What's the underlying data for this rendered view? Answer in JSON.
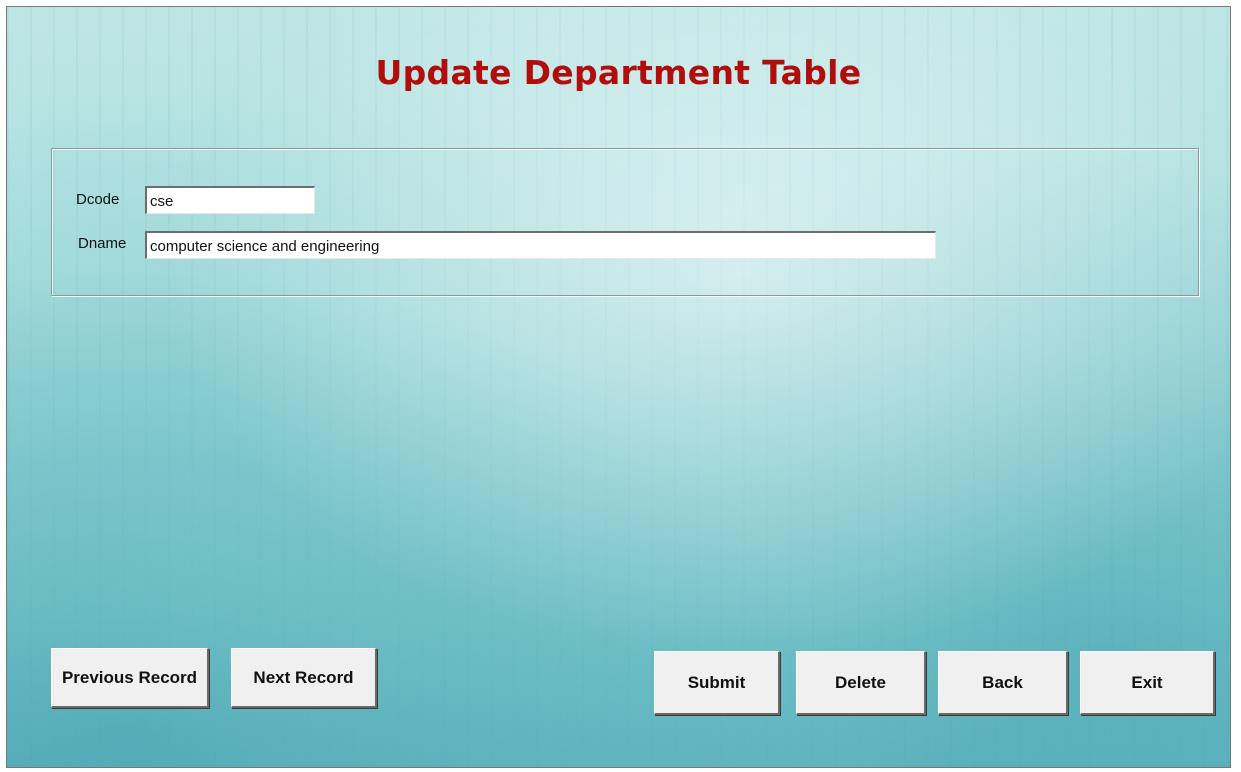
{
  "header": {
    "title": "Update Department Table"
  },
  "form": {
    "fields": [
      {
        "label": "Dcode",
        "value": "cse"
      },
      {
        "label": "Dname",
        "value": "computer science and engineering"
      }
    ]
  },
  "navigation": {
    "previous_label": "Previous Record",
    "next_label": "Next Record"
  },
  "actions": {
    "submit_label": "Submit",
    "delete_label": "Delete",
    "back_label": "Back",
    "exit_label": "Exit"
  },
  "colors": {
    "title": "#b10d0d",
    "background": "#a7dcdc",
    "button_face": "#f0f0f0"
  }
}
